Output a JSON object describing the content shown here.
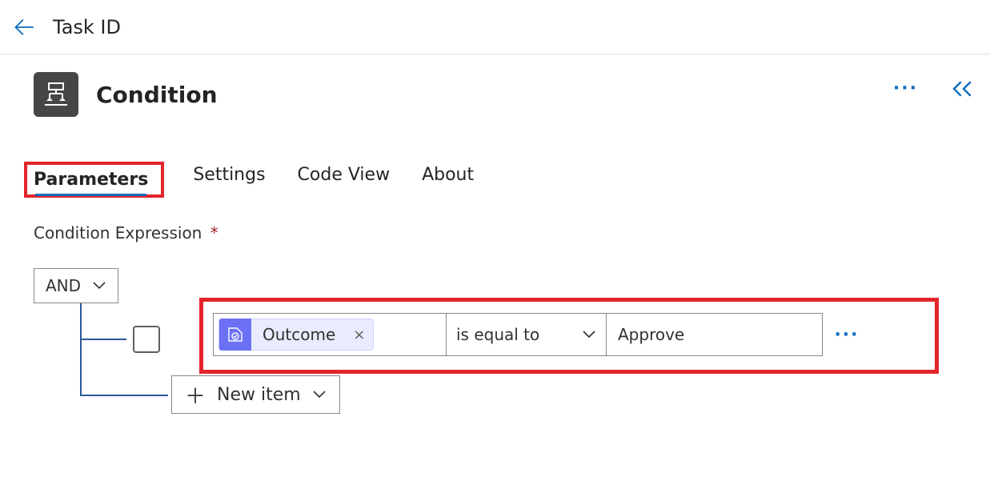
{
  "header": {
    "title": "Task ID"
  },
  "node": {
    "title": "Condition"
  },
  "tabs": {
    "parameters": "Parameters",
    "settings": "Settings",
    "code_view": "Code View",
    "about": "About"
  },
  "section": {
    "label": "Condition Expression",
    "required": "*"
  },
  "expression": {
    "logic_op": "AND",
    "row": {
      "token_label": "Outcome",
      "token_remove": "×",
      "operator": "is equal to",
      "value": "Approve"
    },
    "new_item_label": "New item"
  },
  "colors": {
    "accent": "#0F6CBD",
    "highlight": "#E3242B",
    "token_bg": "#E9EBFE",
    "token_icon_bg": "#6B70F5",
    "node_icon_bg": "#484644"
  }
}
